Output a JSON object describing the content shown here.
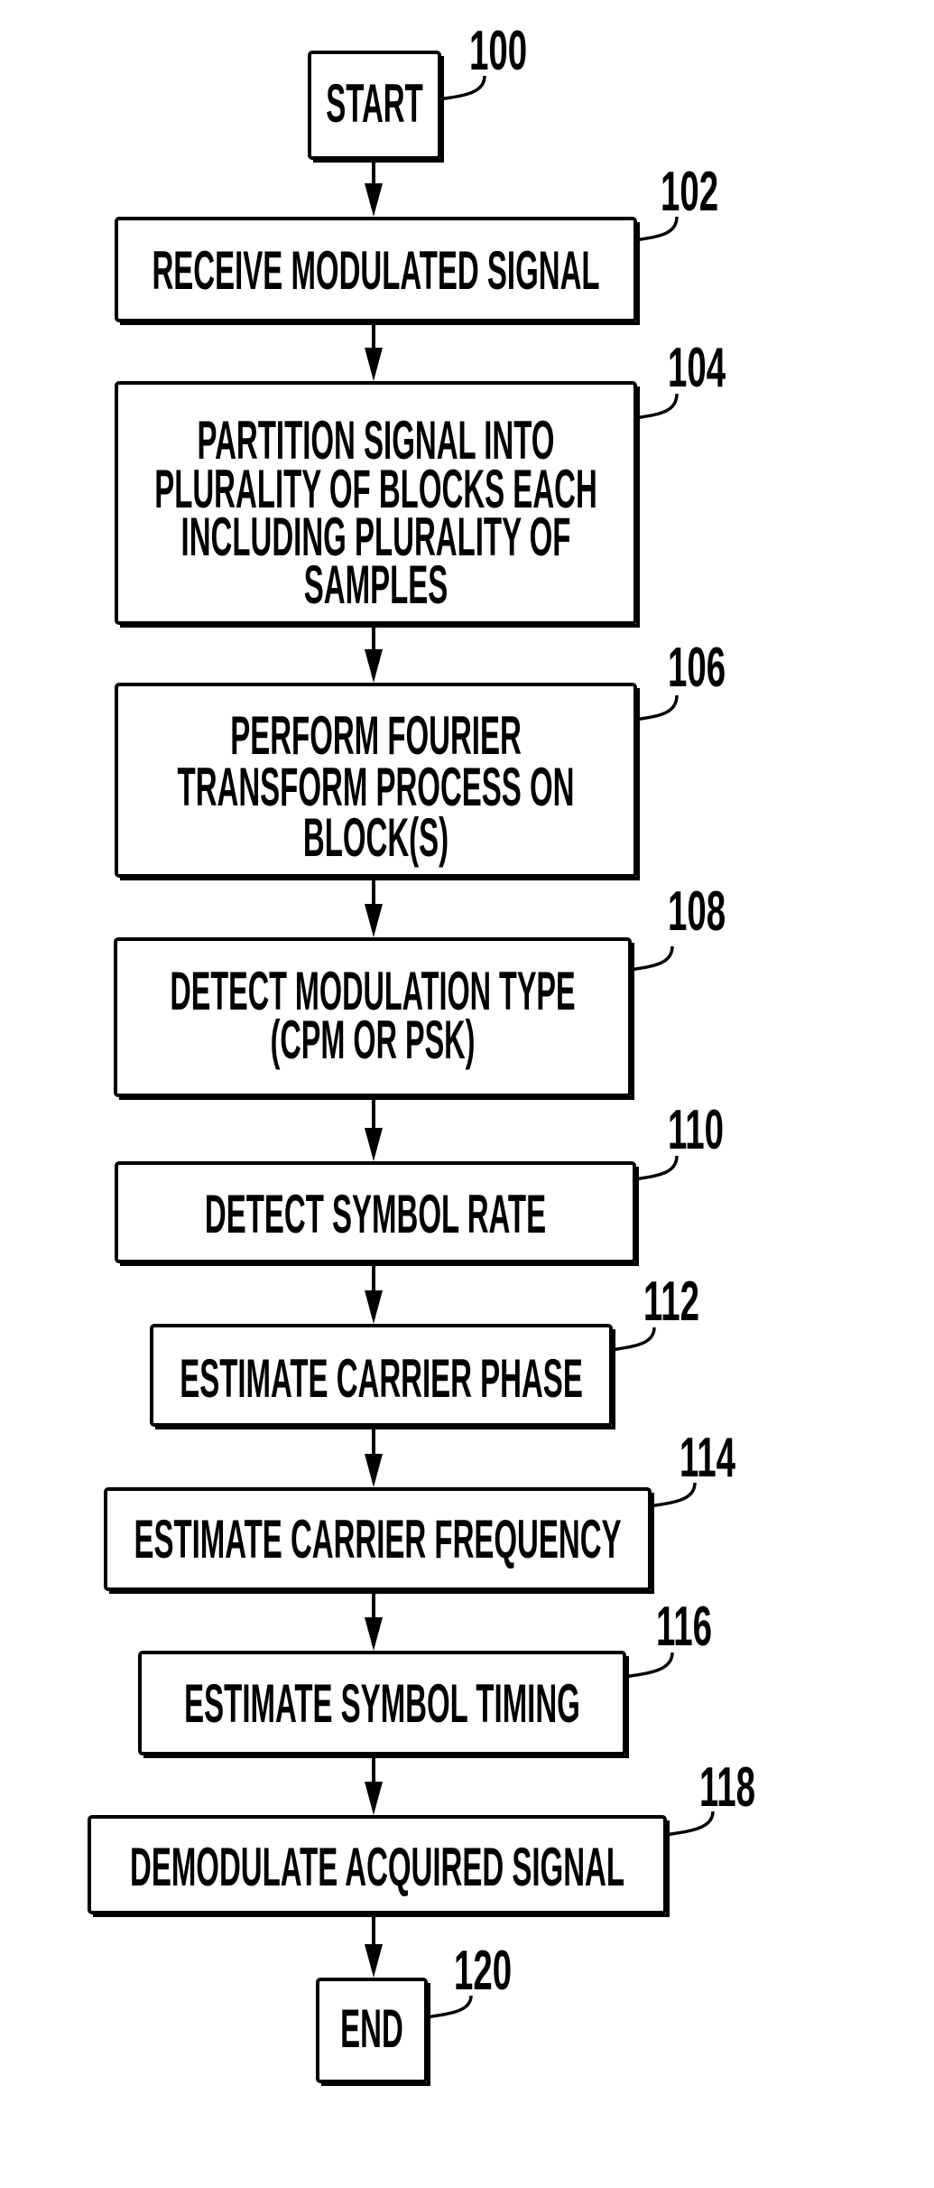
{
  "diagram": {
    "type": "flowchart",
    "direction": "top-to-bottom",
    "steps": [
      {
        "ref": "100",
        "kind": "terminal",
        "lines": [
          "START"
        ]
      },
      {
        "ref": "102",
        "kind": "process",
        "lines": [
          "RECEIVE MODULATED SIGNAL"
        ]
      },
      {
        "ref": "104",
        "kind": "process",
        "lines": [
          "PARTITION SIGNAL INTO",
          "PLURALITY OF BLOCKS EACH",
          "INCLUDING PLURALITY OF",
          "SAMPLES"
        ]
      },
      {
        "ref": "106",
        "kind": "process",
        "lines": [
          "PERFORM FOURIER",
          "TRANSFORM PROCESS ON",
          "BLOCK(S)"
        ]
      },
      {
        "ref": "108",
        "kind": "process",
        "lines": [
          "DETECT MODULATION TYPE",
          "(CPM OR PSK)"
        ]
      },
      {
        "ref": "110",
        "kind": "process",
        "lines": [
          "DETECT SYMBOL RATE"
        ]
      },
      {
        "ref": "112",
        "kind": "process",
        "lines": [
          "ESTIMATE CARRIER PHASE"
        ]
      },
      {
        "ref": "114",
        "kind": "process",
        "lines": [
          "ESTIMATE CARRIER FREQUENCY"
        ]
      },
      {
        "ref": "116",
        "kind": "process",
        "lines": [
          "ESTIMATE SYMBOL TIMING"
        ]
      },
      {
        "ref": "118",
        "kind": "process",
        "lines": [
          "DEMODULATE ACQUIRED SIGNAL"
        ]
      },
      {
        "ref": "120",
        "kind": "terminal",
        "lines": [
          "END"
        ]
      }
    ],
    "edges": [
      [
        "100",
        "102"
      ],
      [
        "102",
        "104"
      ],
      [
        "104",
        "106"
      ],
      [
        "106",
        "108"
      ],
      [
        "108",
        "110"
      ],
      [
        "110",
        "112"
      ],
      [
        "112",
        "114"
      ],
      [
        "114",
        "116"
      ],
      [
        "116",
        "118"
      ],
      [
        "118",
        "120"
      ]
    ]
  }
}
